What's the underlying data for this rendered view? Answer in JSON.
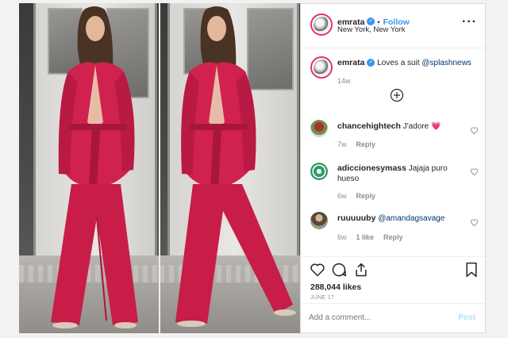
{
  "post": {
    "username": "emrata",
    "follow_label": "Follow",
    "location": "New York, New York",
    "caption_user": "emrata",
    "caption_text": "Loves a suit",
    "caption_mention": "@splashnews",
    "caption_age": "14w"
  },
  "comments": [
    {
      "user": "chancehightech",
      "text": "J'adore 💗",
      "age": "7w",
      "reply": "Reply"
    },
    {
      "user": "adiccionesymass",
      "text": "Jajaja puro hueso",
      "age": "6w",
      "reply": "Reply"
    },
    {
      "user": "ruuuuuby",
      "text": "@amandagsavage",
      "age": "6w",
      "likes": "1 like",
      "reply": "Reply"
    }
  ],
  "engagement": {
    "likes": "288,044 likes",
    "date": "JUNE 17"
  },
  "comment_box": {
    "placeholder": "Add a comment...",
    "post_label": "Post"
  },
  "colors": {
    "suit": "#d0214f",
    "link": "#3897f0",
    "muted": "#8e8e8e"
  },
  "icons": [
    "more-icon",
    "load-more-icon",
    "heart-icon",
    "comment-icon",
    "share-icon",
    "bookmark-icon",
    "verified-icon"
  ]
}
